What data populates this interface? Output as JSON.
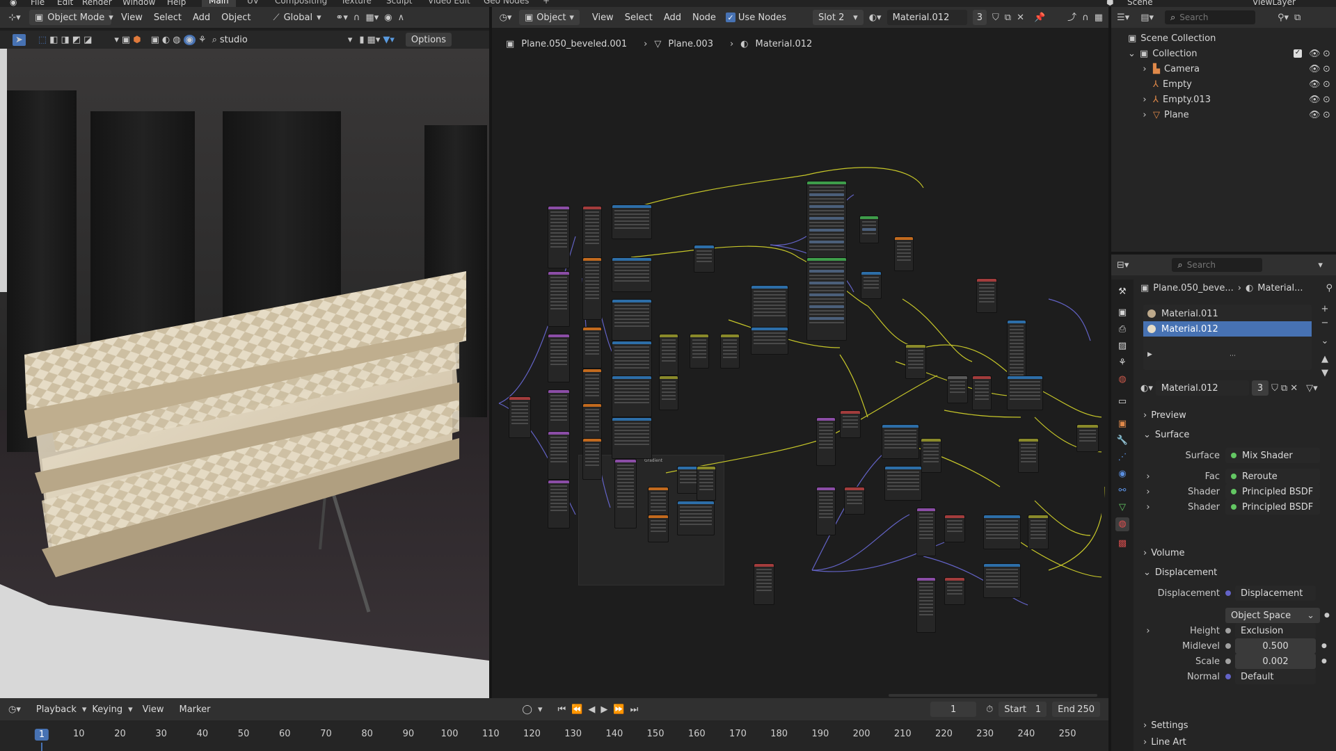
{
  "topbar": {
    "menus": [
      "File",
      "Edit",
      "Render",
      "Window",
      "Help"
    ],
    "workspaces": [
      "Main",
      "UV",
      "Compositing",
      "Texture",
      "Sculpt",
      "Video Edit",
      "Geo Nodes"
    ],
    "active_workspace": "Main",
    "add_tab": "+",
    "scene": "Scene",
    "view_layer": "ViewLayer"
  },
  "viewport_header": {
    "mode": "Object Mode",
    "menus": [
      "View",
      "Select",
      "Add",
      "Object"
    ],
    "transform": "Global",
    "search_value": "studio",
    "options_label": "Options"
  },
  "node_header": {
    "editor_type": "Object",
    "menus": [
      "View",
      "Select",
      "Add",
      "Node"
    ],
    "use_nodes_label": "Use Nodes",
    "use_nodes_checked": true,
    "slot": "Slot 2",
    "material": "Material.012",
    "users": "3"
  },
  "breadcrumb": {
    "object": "Plane.050_beveled.001",
    "mesh": "Plane.003",
    "material": "Material.012"
  },
  "node_frame": {
    "label": "Gradient"
  },
  "outliner": {
    "search_placeholder": "Search",
    "root": "Scene Collection",
    "collection": "Collection",
    "items": [
      {
        "name": "Camera",
        "icon": "camera-icon",
        "color": "#e0894a"
      },
      {
        "name": "Empty",
        "icon": "empty-icon",
        "color": "#e0894a"
      },
      {
        "name": "Empty.013",
        "icon": "empty-icon",
        "color": "#e0894a"
      },
      {
        "name": "Plane",
        "icon": "mesh-icon",
        "color": "#e0894a"
      }
    ]
  },
  "properties": {
    "search_placeholder": "Search",
    "breadcrumb_object": "Plane.050_beve...",
    "breadcrumb_material": "Material...",
    "slots": [
      "Material.011",
      "Material.012"
    ],
    "selected_slot": "Material.012",
    "material_name": "Material.012",
    "material_users": "3",
    "sections": {
      "preview": "Preview",
      "surface": "Surface",
      "volume": "Volume",
      "displacement": "Displacement",
      "settings": "Settings",
      "line_art": "Line Art"
    },
    "surface": {
      "surface_label": "Surface",
      "surface_value": "Mix Shader",
      "fac_label": "Fac",
      "fac_value": "Reroute",
      "shader1_label": "Shader",
      "shader1_value": "Principled BSDF",
      "shader2_label": "Shader",
      "shader2_value": "Principled BSDF"
    },
    "displacement": {
      "disp_label": "Displacement",
      "disp_value": "Displacement",
      "space_value": "Object Space",
      "height_label": "Height",
      "height_value": "Exclusion",
      "midlevel_label": "Midlevel",
      "midlevel_value": "0.500",
      "scale_label": "Scale",
      "scale_value": "0.002",
      "normal_label": "Normal",
      "normal_value": "Default"
    }
  },
  "timeline": {
    "menus": [
      "Playback",
      "Keying",
      "View",
      "Marker"
    ],
    "current_frame": "1",
    "start_label": "Start",
    "start_value": "1",
    "end_label": "End",
    "end_value": "250",
    "ticks": [
      "1",
      "10",
      "20",
      "30",
      "40",
      "50",
      "60",
      "70",
      "80",
      "90",
      "100",
      "110",
      "120",
      "130",
      "140",
      "150",
      "160",
      "170",
      "180",
      "190",
      "200",
      "210",
      "220",
      "230",
      "240",
      "250"
    ]
  },
  "colors": {
    "accent": "#4772b3",
    "shader_socket": "#63c763",
    "vector_socket": "#6363c7",
    "link_yellow": "#c7c729",
    "link_purple": "#6363c7"
  }
}
